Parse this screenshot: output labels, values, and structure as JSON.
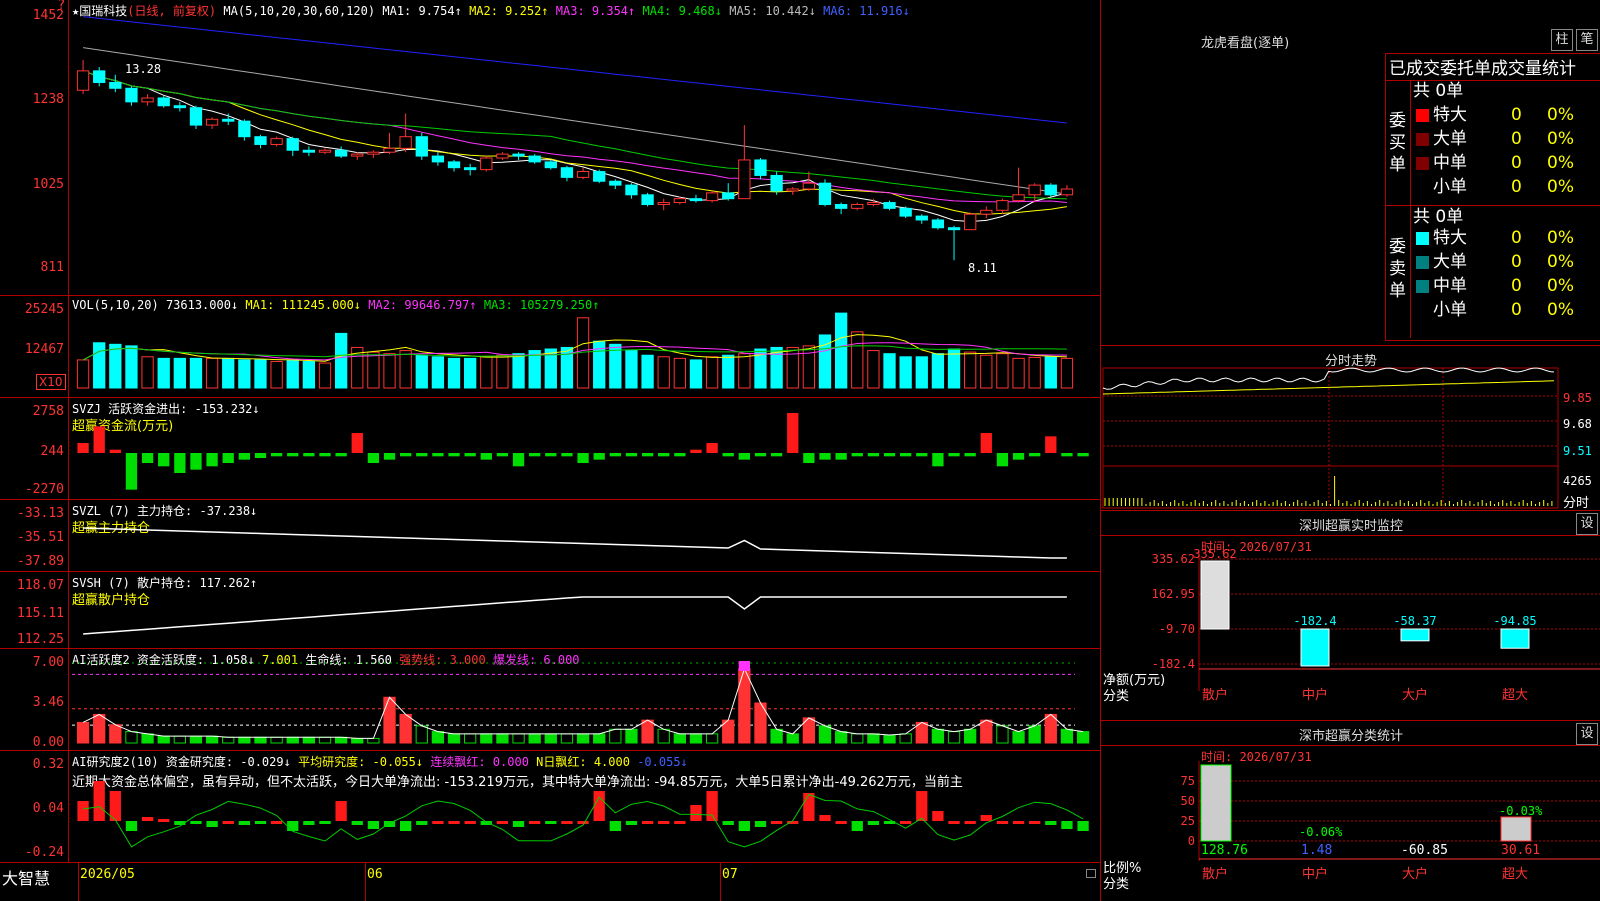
{
  "colors": {
    "bg": "#000000",
    "frame": "#b00000",
    "up": "#ff3333",
    "down": "#00ffff",
    "vol_up": "#ff3333",
    "flow_pos": "#ff1a1a",
    "flow_neg": "#00dd00",
    "ma1": "#ffffff",
    "ma2": "#ffff00",
    "ma3": "#ff33ff",
    "ma4": "#00cc00",
    "ma5": "#aaaaaa",
    "ma6": "#2222ff"
  },
  "app": {
    "brand": "大智慧"
  },
  "kline": {
    "stock_name": "国瑞科技",
    "mode": "(日线, 前复权)",
    "ma_def": "MA(5,10,20,30,60,120)",
    "ma1": "MA1: 9.754↑",
    "ma2": "MA2: 9.252↑",
    "ma3": "MA3: 9.354↑",
    "ma4": "MA4: 9.468↓",
    "ma5": "MA5: 10.442↓",
    "ma6": "MA6: 11.916↓",
    "axis_labels": [
      "1452",
      "1238",
      "1025",
      "811"
    ],
    "high_label": "13.28",
    "low_label": "8.11"
  },
  "vol": {
    "def": "VOL(5,10,20)",
    "vol": "73613.000↓",
    "ma1": "MA1: 111245.000↓",
    "ma2": "MA2: 99646.797↑",
    "ma3": "MA3: 105279.250↑",
    "axis_labels": [
      "25245",
      "12467"
    ],
    "unit": "X10"
  },
  "svzj": {
    "def": "SVZJ",
    "title": "活跃资金进出: -153.232↓",
    "sub": "超赢资金流(万元)",
    "axis_labels": [
      "2758",
      "244",
      "-2270"
    ]
  },
  "svzl": {
    "def": "SVZL (7)",
    "title": "主力持仓: -37.238↓",
    "sub": "超赢主力持仓",
    "axis_labels": [
      "-33.13",
      "-35.51",
      "-37.89"
    ]
  },
  "svsh": {
    "def": "SVSH (7)",
    "title": "散户持仓: 117.262↑",
    "sub": "超赢散户持仓",
    "axis_labels": [
      "118.07",
      "115.11",
      "112.25"
    ]
  },
  "ai1": {
    "def": "AI活跃度2",
    "t1": "资金活跃度: 1.058↓",
    "t2": "7.001",
    "t3": "生命线: 1.560",
    "t4": "强势线: 3.000",
    "t5": "爆发线: 6.000",
    "axis_labels": [
      "7.00",
      "3.46",
      "0.00"
    ]
  },
  "ai2": {
    "def": "AI研究度2(10)",
    "t1": "资金研究度: -0.029↓",
    "t2": "平均研究度: -0.055↓",
    "t3": "连续飘红: 0.000",
    "t4": "N日飘红: 4.000",
    "t5": "-0.055↓",
    "comment": "近期大资金总体偏空，虽有异动，但不太活跃，今日大单净流出: -153.219万元，其中特大单净流出: -94.85万元，大单5日累计净出-49.262万元，当前主",
    "axis_labels": [
      "0.32",
      "0.04",
      "-0.24"
    ]
  },
  "dates": [
    "2026/05",
    "06",
    "07"
  ],
  "longhu": {
    "title": "龙虎看盘(逐单)",
    "btn1": "柱",
    "btn2": "笔",
    "header": "已成交委托单成交量统计",
    "buy_label": "委买单",
    "sell_label": "委卖单",
    "buy_total": "共 0单",
    "sell_total": "共 0单",
    "buy_rows": [
      {
        "name": "特大",
        "v": "0",
        "p": "0%"
      },
      {
        "name": "大单",
        "v": "0",
        "p": "0%"
      },
      {
        "name": "中单",
        "v": "0",
        "p": "0%"
      },
      {
        "name": "小单",
        "v": "0",
        "p": "0%"
      }
    ],
    "sell_rows": [
      {
        "name": "特大",
        "v": "0",
        "p": "0%"
      },
      {
        "name": "大单",
        "v": "0",
        "p": "0%"
      },
      {
        "name": "中单",
        "v": "0",
        "p": "0%"
      },
      {
        "name": "小单",
        "v": "0",
        "p": "0%"
      }
    ]
  },
  "intraday": {
    "title": "分时走势",
    "p1": "9.85",
    "p2": "9.68",
    "p3": "9.51",
    "vol": "4265",
    "vol_lbl": "分时"
  },
  "monitor": {
    "title": "深圳超赢实时监控",
    "btn": "设",
    "time": "时间: 2026/07/31",
    "axis": [
      "335.62",
      "162.95",
      "-9.70",
      "-182.4"
    ],
    "bar_vals": [
      "335.62",
      "-182.4",
      "-58.37",
      "-94.85"
    ],
    "ylabel1": "净额(万元)",
    "ylabel2": "分类",
    "cats": [
      "散户",
      "中户",
      "大户",
      "超大"
    ]
  },
  "classify": {
    "title": "深市超赢分类统计",
    "btn": "设",
    "time": "时间: 2026/07/31",
    "axis": [
      "75",
      "50",
      "25",
      "0"
    ],
    "pct_labels": [
      "-0.06%",
      "-0.03%"
    ],
    "bottom_vals": [
      "128.76",
      "1.48",
      "-60.85",
      "30.61"
    ],
    "ylabel1": "比例%",
    "ylabel2": "分类",
    "cats": [
      "散户",
      "中户",
      "大户",
      "超大"
    ]
  },
  "chart_data": {
    "type": "candlestick",
    "candles": [
      [
        12.5,
        13.28,
        12.4,
        13.0
      ],
      [
        13.0,
        13.1,
        12.6,
        12.7
      ],
      [
        12.7,
        12.9,
        12.45,
        12.55
      ],
      [
        12.55,
        12.6,
        12.1,
        12.2
      ],
      [
        12.2,
        12.4,
        12.1,
        12.3
      ],
      [
        12.3,
        12.35,
        12.05,
        12.1
      ],
      [
        12.1,
        12.2,
        11.95,
        12.05
      ],
      [
        12.05,
        12.1,
        11.5,
        11.6
      ],
      [
        11.6,
        11.8,
        11.5,
        11.75
      ],
      [
        11.75,
        11.9,
        11.6,
        11.7
      ],
      [
        11.7,
        11.75,
        11.2,
        11.3
      ],
      [
        11.3,
        11.35,
        11.0,
        11.1
      ],
      [
        11.1,
        11.3,
        11.05,
        11.25
      ],
      [
        11.25,
        11.3,
        10.8,
        10.95
      ],
      [
        10.95,
        11.05,
        10.8,
        10.9
      ],
      [
        10.9,
        11.0,
        10.85,
        10.95
      ],
      [
        10.95,
        11.05,
        10.75,
        10.8
      ],
      [
        10.8,
        10.9,
        10.7,
        10.85
      ],
      [
        10.85,
        10.95,
        10.75,
        10.9
      ],
      [
        10.9,
        11.4,
        10.85,
        11.0
      ],
      [
        11.0,
        11.9,
        10.9,
        11.3
      ],
      [
        11.3,
        11.4,
        10.7,
        10.8
      ],
      [
        10.8,
        10.9,
        10.55,
        10.65
      ],
      [
        10.65,
        10.7,
        10.4,
        10.5
      ],
      [
        10.5,
        10.6,
        10.3,
        10.45
      ],
      [
        10.45,
        10.8,
        10.4,
        10.75
      ],
      [
        10.75,
        10.9,
        10.7,
        10.85
      ],
      [
        10.85,
        10.9,
        10.7,
        10.8
      ],
      [
        10.8,
        10.85,
        10.6,
        10.65
      ],
      [
        10.65,
        10.7,
        10.45,
        10.5
      ],
      [
        10.5,
        10.55,
        10.15,
        10.25
      ],
      [
        10.25,
        10.5,
        10.2,
        10.4
      ],
      [
        10.4,
        10.45,
        10.1,
        10.15
      ],
      [
        10.15,
        10.2,
        9.95,
        10.05
      ],
      [
        10.05,
        10.1,
        9.7,
        9.8
      ],
      [
        9.8,
        9.85,
        9.5,
        9.55
      ],
      [
        9.55,
        9.7,
        9.4,
        9.6
      ],
      [
        9.6,
        9.75,
        9.55,
        9.7
      ],
      [
        9.7,
        9.8,
        9.6,
        9.65
      ],
      [
        9.65,
        9.9,
        9.6,
        9.85
      ],
      [
        9.85,
        10.1,
        9.65,
        9.7
      ],
      [
        9.7,
        11.6,
        9.7,
        10.7
      ],
      [
        10.7,
        10.75,
        10.2,
        10.3
      ],
      [
        10.3,
        10.4,
        9.8,
        9.9
      ],
      [
        9.9,
        10.0,
        9.8,
        9.95
      ],
      [
        9.95,
        10.4,
        9.9,
        10.1
      ],
      [
        10.1,
        10.2,
        9.5,
        9.55
      ],
      [
        9.55,
        9.6,
        9.3,
        9.45
      ],
      [
        9.45,
        9.6,
        9.4,
        9.55
      ],
      [
        9.55,
        9.7,
        9.5,
        9.6
      ],
      [
        9.6,
        9.65,
        9.4,
        9.45
      ],
      [
        9.45,
        9.5,
        9.2,
        9.25
      ],
      [
        9.25,
        9.3,
        9.05,
        9.15
      ],
      [
        9.15,
        9.2,
        8.9,
        8.95
      ],
      [
        8.95,
        9.0,
        8.11,
        8.9
      ],
      [
        8.9,
        9.35,
        8.9,
        9.3
      ],
      [
        9.3,
        9.5,
        9.2,
        9.4
      ],
      [
        9.4,
        9.7,
        9.3,
        9.65
      ],
      [
        9.65,
        10.5,
        9.6,
        9.8
      ],
      [
        9.8,
        10.1,
        9.6,
        10.05
      ],
      [
        10.05,
        10.1,
        9.75,
        9.8
      ],
      [
        9.8,
        10.05,
        9.75,
        9.95
      ]
    ],
    "volume": [
      9000,
      14500,
      14000,
      13500,
      10000,
      9500,
      9500,
      9500,
      9500,
      9500,
      9000,
      9000,
      8500,
      9000,
      8500,
      8000,
      17500,
      13000,
      11500,
      11000,
      12000,
      10500,
      10000,
      9500,
      9500,
      10000,
      10500,
      11000,
      12000,
      12500,
      13000,
      22500,
      15000,
      14000,
      12000,
      10500,
      10000,
      9500,
      9000,
      10000,
      10500,
      11000,
      12500,
      13000,
      13000,
      13500,
      17000,
      24000,
      18000,
      12000,
      11000,
      10000,
      10000,
      11000,
      12500,
      11500,
      10500,
      11000,
      9500,
      9800,
      10000,
      9500
    ],
    "flow": [
      300,
      800,
      100,
      -1100,
      -300,
      -400,
      -600,
      -500,
      -400,
      -300,
      -200,
      -150,
      -100,
      -100,
      -100,
      -100,
      -100,
      600,
      -300,
      -200,
      -100,
      -100,
      -100,
      -100,
      -100,
      -200,
      -100,
      -400,
      -100,
      -100,
      -100,
      -300,
      -200,
      -100,
      -100,
      -100,
      -100,
      -100,
      100,
      300,
      -100,
      -200,
      -100,
      -100,
      1200,
      -300,
      -200,
      -200,
      -100,
      -100,
      -100,
      -100,
      -100,
      -400,
      -100,
      -100,
      600,
      -400,
      -200,
      -100,
      500,
      -100,
      -100
    ],
    "ai1": [
      1.8,
      2.5,
      1.6,
      1.0,
      0.8,
      0.6,
      0.6,
      0.6,
      0.6,
      0.5,
      0.5,
      0.5,
      0.5,
      0.5,
      0.5,
      0.5,
      0.5,
      0.4,
      0.4,
      4.0,
      2.5,
      1.5,
      1.0,
      0.8,
      0.8,
      0.8,
      0.8,
      0.8,
      0.8,
      0.8,
      0.8,
      0.8,
      0.8,
      1.2,
      1.2,
      2.0,
      1.2,
      0.8,
      0.8,
      0.8,
      2.0,
      6.5,
      3.5,
      1.2,
      0.8,
      2.2,
      1.5,
      1.0,
      0.8,
      0.8,
      0.7,
      0.8,
      1.8,
      1.2,
      1.0,
      1.2,
      2.0,
      1.5,
      1.0,
      1.5,
      2.5,
      1.2,
      1.0
    ],
    "ai2": [
      0.1,
      0.2,
      0.15,
      -0.05,
      0.02,
      0.01,
      -0.02,
      -0.01,
      -0.03,
      0.0,
      -0.02,
      -0.01,
      0.0,
      -0.05,
      -0.02,
      -0.01,
      0.1,
      -0.02,
      -0.04,
      -0.03,
      -0.05,
      -0.02,
      0.0,
      0.0,
      0.0,
      -0.02,
      0.0,
      -0.03,
      0.0,
      -0.01,
      0.0,
      0.0,
      0.15,
      -0.05,
      -0.02,
      0.0,
      0.0,
      0.0,
      0.08,
      0.15,
      -0.02,
      -0.05,
      -0.03,
      0.0,
      0.0,
      0.14,
      0.03,
      0.0,
      -0.05,
      -0.02,
      -0.01,
      0.0,
      0.15,
      0.05,
      0.0,
      0.0,
      0.03,
      0.0,
      0.0,
      0.0,
      -0.02,
      -0.04,
      -0.05
    ]
  }
}
